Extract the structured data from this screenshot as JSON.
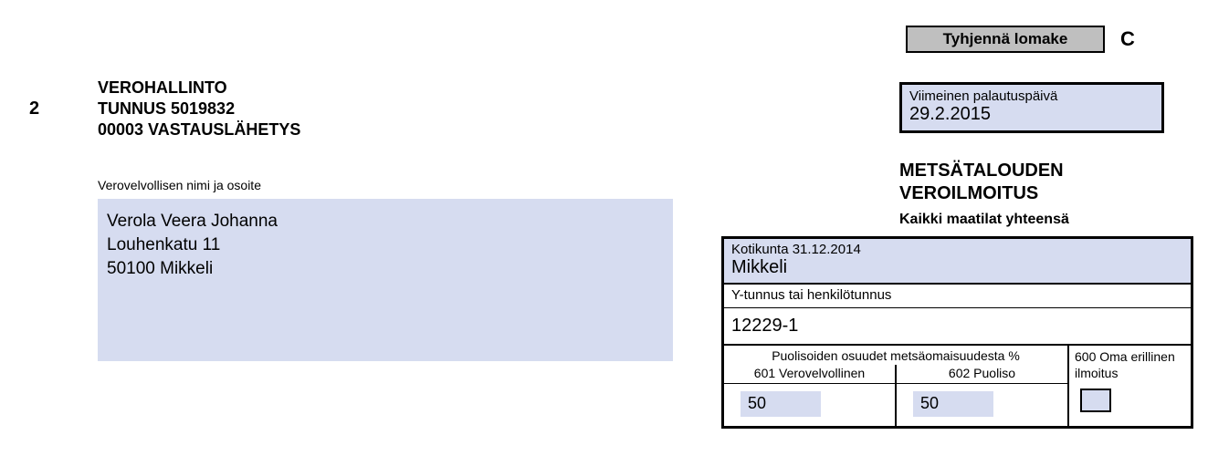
{
  "button": {
    "clear_label": "Tyhjennä lomake"
  },
  "form_letter": "C",
  "form_number": "2",
  "sender": {
    "line1": "VEROHALLINTO",
    "line2": "TUNNUS 5019832",
    "line3": "00003 VASTAUSLÄHETYS"
  },
  "name_address": {
    "label": "Verovelvollisen nimi ja osoite",
    "line1": "Verola Veera Johanna",
    "line2": "Louhenkatu 11",
    "line3": "50100 Mikkeli"
  },
  "return_date": {
    "label": "Viimeinen palautuspäivä",
    "value": "29.2.2015"
  },
  "title": {
    "line1": "METSÄTALOUDEN",
    "line2": "VEROILMOITUS",
    "subtitle": "Kaikki maatilat yhteensä"
  },
  "kotikunta": {
    "label": "Kotikunta 31.12.2014",
    "value": "Mikkeli"
  },
  "ytunnus": {
    "label": "Y-tunnus tai henkilötunnus",
    "value": "12229-1"
  },
  "shares": {
    "header": "Puolisoiden osuudet metsäomaisuudesta %",
    "col1_label": "601 Verovelvollinen",
    "col1_value": "50",
    "col2_label": "602 Puoliso",
    "col2_value": "50"
  },
  "own": {
    "label": "600 Oma erillinen ilmoitus"
  }
}
